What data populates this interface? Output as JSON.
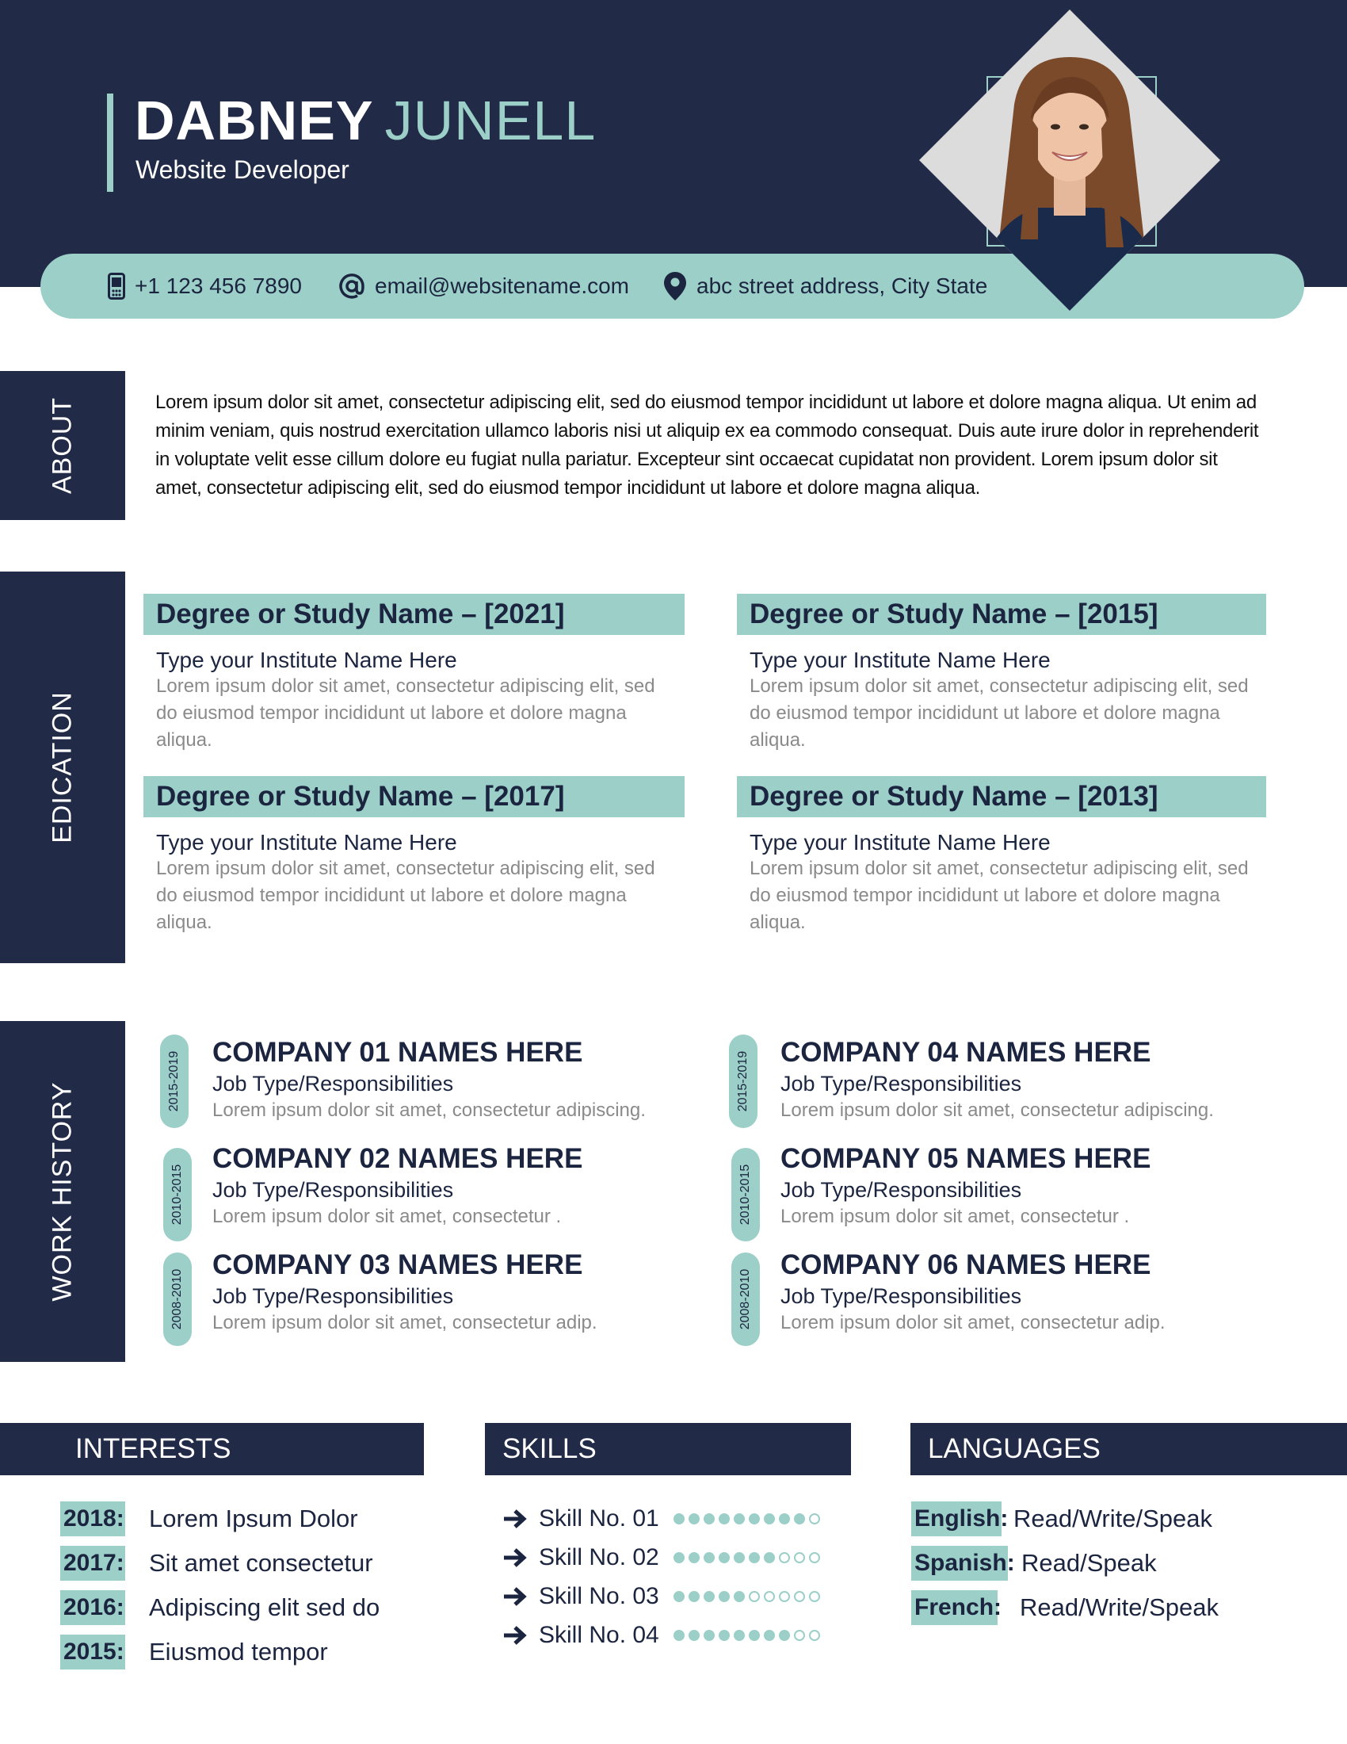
{
  "header": {
    "first_name": "DABNEY",
    "last_name": "JUNELL",
    "title": "Website Developer"
  },
  "contact": {
    "phone": "+1 123 456 7890",
    "email": "email@websitename.com",
    "address": "abc street address, City State"
  },
  "sections": {
    "about": "ABOUT",
    "education": "EDICATION",
    "work": "WORK HISTORY",
    "interests": "INTERESTS",
    "skills": "SKILLS",
    "languages": "LANGUAGES"
  },
  "about_text": "Lorem ipsum dolor sit amet, consectetur adipiscing elit, sed do eiusmod tempor incididunt ut labore et dolore magna aliqua. Ut enim ad minim veniam, quis nostrud exercitation ullamco laboris nisi ut aliquip ex ea commodo consequat. Duis aute irure dolor in reprehenderit in voluptate velit esse cillum dolore eu fugiat nulla pariatur. Excepteur sint occaecat cupidatat non provident. Lorem ipsum dolor sit amet, consectetur adipiscing elit, sed do eiusmod tempor incididunt ut labore et dolore magna aliqua.",
  "education": [
    {
      "title": "Degree or Study Name – [2021]",
      "institute": "Type your Institute Name Here",
      "desc": "Lorem ipsum dolor sit amet, consectetur adipiscing elit, sed do eiusmod tempor incididunt ut labore et dolore magna aliqua."
    },
    {
      "title": "Degree or Study Name – [2015]",
      "institute": "Type your Institute Name Here",
      "desc": "Lorem ipsum dolor sit amet, consectetur adipiscing elit, sed do eiusmod tempor incididunt ut labore et dolore magna aliqua."
    },
    {
      "title": "Degree or Study Name – [2017]",
      "institute": "Type your Institute Name Here",
      "desc": "Lorem ipsum dolor sit amet, consectetur adipiscing elit, sed do eiusmod tempor incididunt ut labore et dolore magna aliqua."
    },
    {
      "title": "Degree or Study Name – [2013]",
      "institute": "Type your Institute Name Here",
      "desc": "Lorem ipsum dolor sit amet, consectetur adipiscing elit, sed do eiusmod tempor incididunt ut labore et dolore magna aliqua."
    }
  ],
  "work": [
    {
      "dates": "2015-2019",
      "company": "COMPANY 01 NAMES HERE",
      "role": "Job Type/Responsibilities",
      "desc": "Lorem ipsum dolor sit amet, consectetur adipiscing."
    },
    {
      "dates": "2010-2015",
      "company": "COMPANY 02 NAMES HERE",
      "role": "Job Type/Responsibilities",
      "desc": "Lorem ipsum dolor sit amet, consectetur ."
    },
    {
      "dates": "2008-2010",
      "company": "COMPANY 03 NAMES HERE",
      "role": "Job Type/Responsibilities",
      "desc": "Lorem ipsum dolor sit amet, consectetur  adip."
    },
    {
      "dates": "2015-2019",
      "company": "COMPANY 04 NAMES HERE",
      "role": "Job Type/Responsibilities",
      "desc": "Lorem ipsum dolor sit amet, consectetur adipiscing."
    },
    {
      "dates": "2010-2015",
      "company": "COMPANY 05 NAMES HERE",
      "role": "Job Type/Responsibilities",
      "desc": "Lorem ipsum dolor sit amet, consectetur ."
    },
    {
      "dates": "2008-2010",
      "company": "COMPANY 06 NAMES HERE",
      "role": "Job Type/Responsibilities",
      "desc": "Lorem ipsum dolor sit amet, consectetur  adip."
    }
  ],
  "interests": [
    {
      "year": "2018:",
      "text": "Lorem Ipsum Dolor"
    },
    {
      "year": "2017:",
      "text": "Sit amet consectetur"
    },
    {
      "year": "2016:",
      "text": "Adipiscing elit sed do"
    },
    {
      "year": "2015:",
      "text": "Eiusmod tempor"
    }
  ],
  "skills": [
    {
      "name": "Skill No. 01",
      "level": 9,
      "max": 10
    },
    {
      "name": "Skill No. 02",
      "level": 7,
      "max": 10
    },
    {
      "name": "Skill No. 03",
      "level": 5,
      "max": 10
    },
    {
      "name": "Skill No. 04",
      "level": 8,
      "max": 10
    }
  ],
  "languages": [
    {
      "lang": "English:",
      "level": "Read/Write/Speak"
    },
    {
      "lang": "Spanish:",
      "level": "Read/Speak"
    },
    {
      "lang": "French:",
      "level": "Read/Write/Speak"
    }
  ],
  "colors": {
    "navy": "#212a47",
    "teal": "#9bcfc8"
  },
  "icons": {
    "phone": "phone-icon",
    "email": "at-icon",
    "address": "location-pin-icon",
    "skill": "arrow-right-icon"
  }
}
